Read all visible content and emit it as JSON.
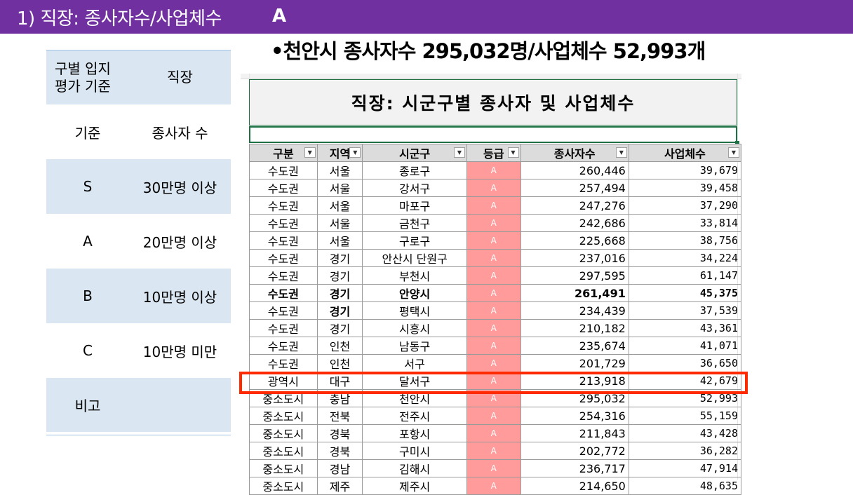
{
  "header": {
    "title": "1) 직장: 종사자수/사업체수",
    "grade": "A"
  },
  "subtitle": "•천안시 종사자수 295,032명/사업체수 52,993개",
  "criteria": {
    "header": [
      "구별 입지\n평가 기준",
      "직장"
    ],
    "rows": [
      {
        "label": "기준",
        "value": "종사자 수"
      },
      {
        "label": "S",
        "value": "30만명 이상"
      },
      {
        "label": "A",
        "value": "20만명 이상"
      },
      {
        "label": "B",
        "value": "10만명 이상"
      },
      {
        "label": "C",
        "value": "10만명 미만"
      },
      {
        "label": "비고",
        "value": ""
      }
    ]
  },
  "sheet": {
    "title": "직장: 시군구별 종사자 및 사업체수",
    "columns": [
      "구분",
      "지역",
      "시군구",
      "등급",
      "종사자수",
      "사업체수"
    ],
    "rows": [
      [
        "수도권",
        "서울",
        "종로구",
        "A",
        "260,446",
        "39,679"
      ],
      [
        "수도권",
        "서울",
        "강서구",
        "A",
        "257,494",
        "39,458"
      ],
      [
        "수도권",
        "서울",
        "마포구",
        "A",
        "247,276",
        "37,290"
      ],
      [
        "수도권",
        "서울",
        "금천구",
        "A",
        "242,686",
        "33,814"
      ],
      [
        "수도권",
        "서울",
        "구로구",
        "A",
        "225,668",
        "38,756"
      ],
      [
        "수도권",
        "경기",
        "안산시 단원구",
        "A",
        "237,016",
        "34,224"
      ],
      [
        "수도권",
        "경기",
        "부천시",
        "A",
        "297,595",
        "61,147"
      ],
      [
        "수도권",
        "경기",
        "안양시",
        "A",
        "261,491",
        "45,375"
      ],
      [
        "수도권",
        "경기",
        "평택시",
        "A",
        "234,439",
        "37,539"
      ],
      [
        "수도권",
        "경기",
        "시흥시",
        "A",
        "210,182",
        "43,361"
      ],
      [
        "수도권",
        "인천",
        "남동구",
        "A",
        "235,674",
        "41,071"
      ],
      [
        "수도권",
        "인천",
        "서구",
        "A",
        "201,729",
        "36,650"
      ],
      [
        "광역시",
        "대구",
        "달서구",
        "A",
        "213,918",
        "42,679"
      ],
      [
        "중소도시",
        "충남",
        "천안시",
        "A",
        "295,032",
        "52,993"
      ],
      [
        "중소도시",
        "전북",
        "전주시",
        "A",
        "254,316",
        "55,159"
      ],
      [
        "중소도시",
        "경북",
        "포항시",
        "A",
        "211,843",
        "43,428"
      ],
      [
        "중소도시",
        "경북",
        "구미시",
        "A",
        "202,772",
        "36,282"
      ],
      [
        "중소도시",
        "경남",
        "김해시",
        "A",
        "236,717",
        "47,914"
      ],
      [
        "중소도시",
        "제주",
        "제주시",
        "A",
        "214,650",
        "48,635"
      ]
    ]
  }
}
